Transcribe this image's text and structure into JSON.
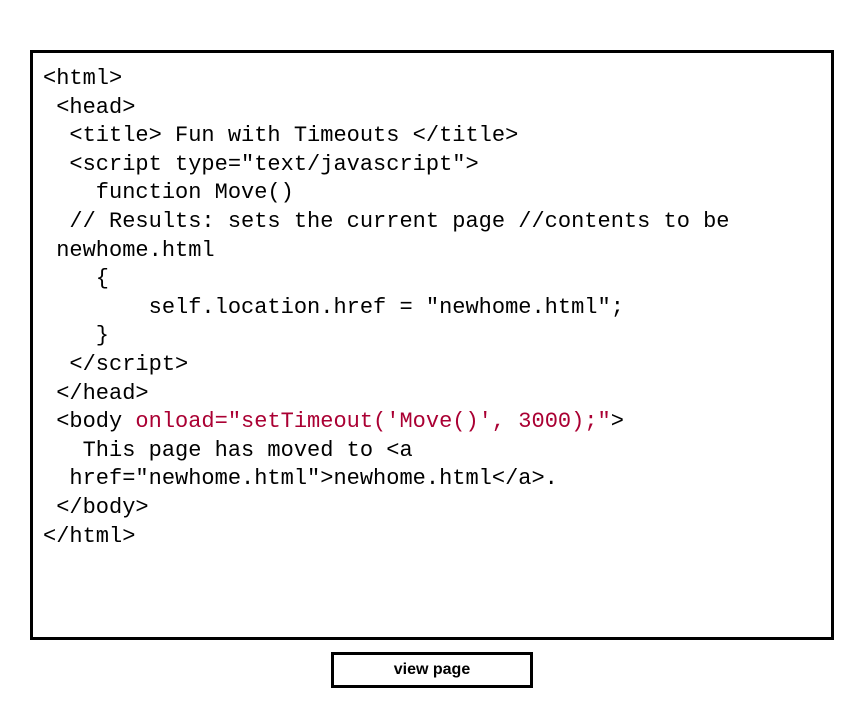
{
  "code": {
    "l1": "<html>",
    "l2": "",
    "l3": " <head>",
    "l4": "  <title> Fun with Timeouts </title>",
    "l5": "  <script type=\"text/javascript\">",
    "l6": "    function Move()",
    "l7": "  // Results: sets the current page //contents to be",
    "l8": " newhome.html",
    "l9": "    {",
    "l10": "        self.location.href = \"newhome.html\";",
    "l11": "    }",
    "l12": "  </scr",
    "l12b": "ipt>",
    "l13": " </head>",
    "l14": "",
    "l15a": " <body ",
    "l15b": "onload=\"setTimeout('Move()', 3000);\"",
    "l15c": ">",
    "l16": "   This page has moved to <a",
    "l17": "  href=\"newhome.html\">newhome.html</a>.",
    "l18": " </body>",
    "l19": "</html>"
  },
  "button": {
    "label": "view page"
  }
}
